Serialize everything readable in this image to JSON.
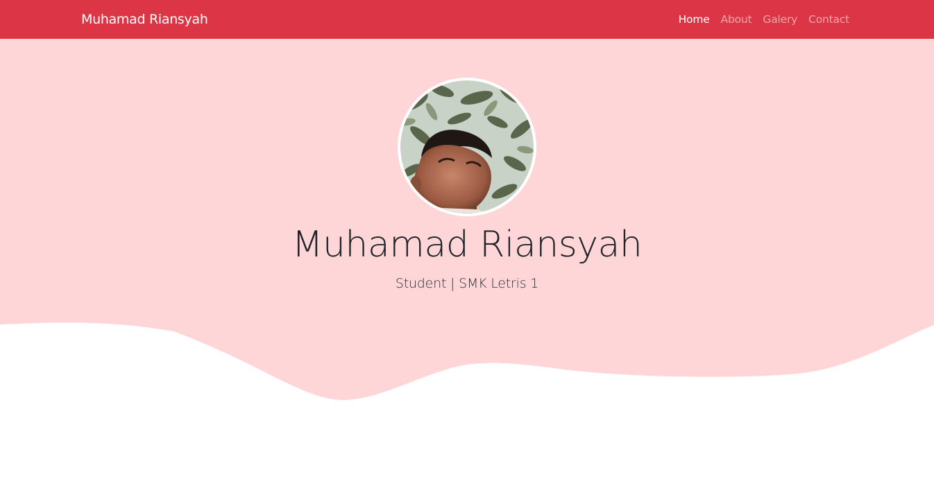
{
  "navbar": {
    "brand": "Muhamad Riansyah",
    "links": [
      {
        "label": "Home",
        "active": true
      },
      {
        "label": "About",
        "active": false
      },
      {
        "label": "Galery",
        "active": false
      },
      {
        "label": "Contact",
        "active": false
      }
    ]
  },
  "hero": {
    "title": "Muhamad Riansyah",
    "subtitle": "Student | SMK Letris 1",
    "avatar_icon": "profile-photo"
  },
  "colors": {
    "navbar_bg": "#dc3545",
    "hero_bg": "#ffd6d8",
    "wave_white": "#ffffff"
  }
}
